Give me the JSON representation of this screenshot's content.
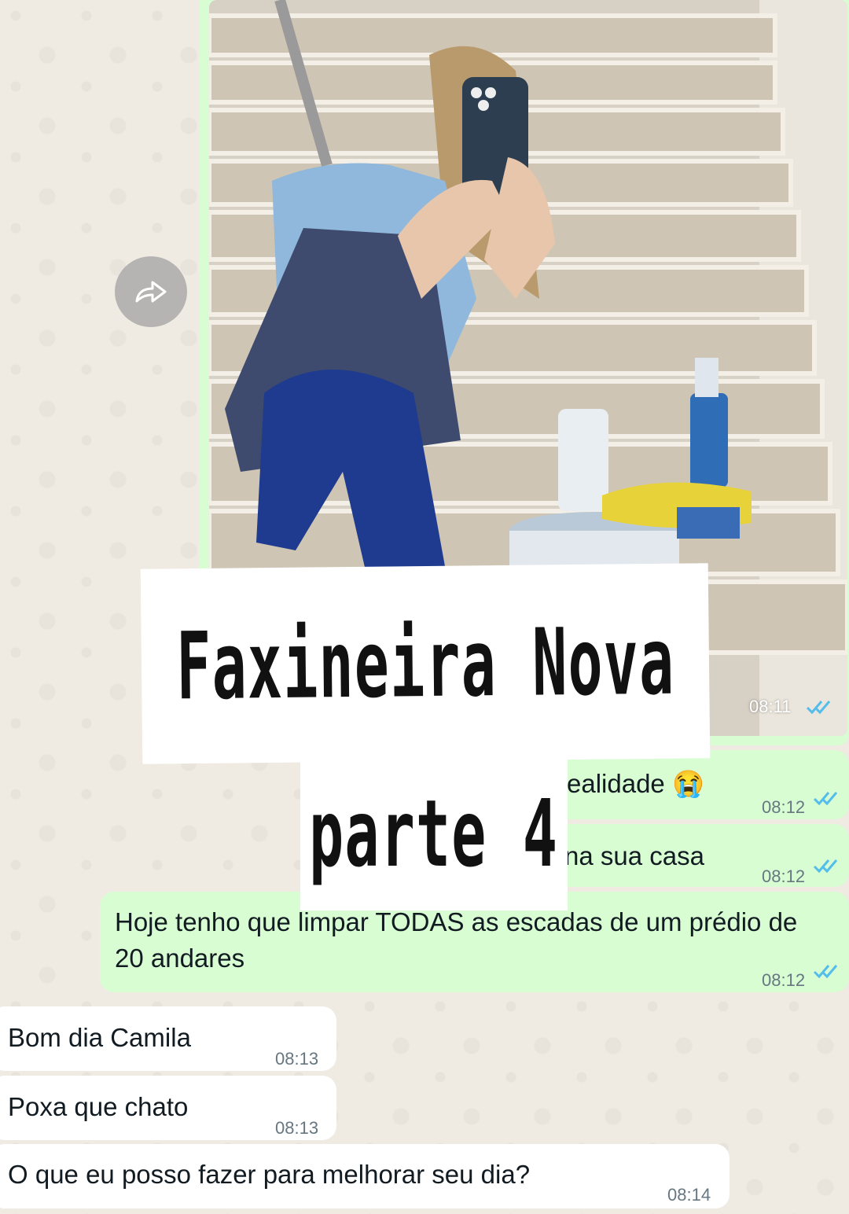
{
  "image_message": {
    "time": "08:11",
    "status": "read"
  },
  "forward_button": {
    "icon": "forward-icon"
  },
  "messages": [
    {
      "direction": "out",
      "text": "realidade 😭",
      "time": "08:12",
      "status": "read"
    },
    {
      "direction": "out",
      "text": "na sua casa",
      "time": "08:12",
      "status": "read"
    },
    {
      "direction": "out",
      "text": "Hoje tenho que limpar TODAS as escadas de um prédio de 20 andares",
      "time": "08:12",
      "status": "read"
    },
    {
      "direction": "in",
      "text": "Bom dia Camila",
      "time": "08:13"
    },
    {
      "direction": "in",
      "text": "Poxa que chato",
      "time": "08:13"
    },
    {
      "direction": "in",
      "text": "O que eu posso fazer para melhorar seu dia?",
      "time": "08:14"
    }
  ],
  "overlay": {
    "title": "Faxineira Nova",
    "subtitle": "parte 4"
  },
  "colors": {
    "chat_background": "#efeae2",
    "outgoing_bubble": "#d9fdd3",
    "incoming_bubble": "#ffffff",
    "read_ticks": "#53bdeb",
    "timestamp": "#667781"
  }
}
